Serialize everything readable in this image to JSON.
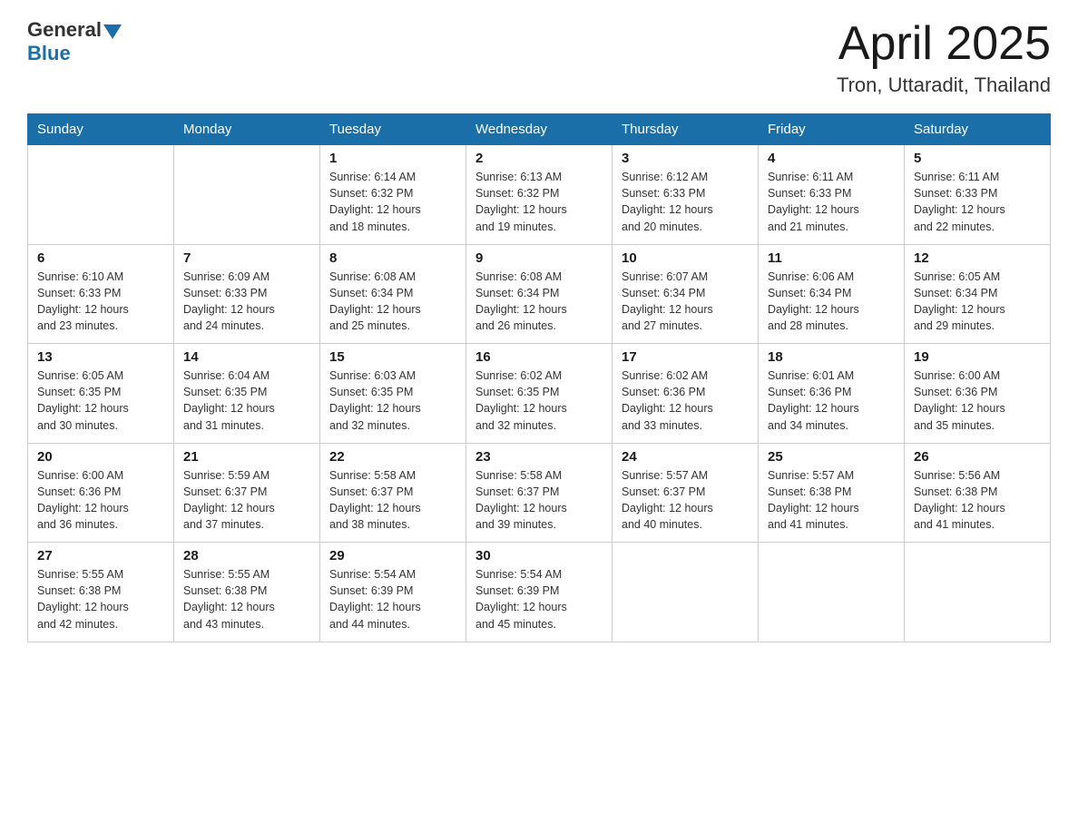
{
  "header": {
    "logo_general": "General",
    "logo_blue": "Blue",
    "month": "April 2025",
    "location": "Tron, Uttaradit, Thailand"
  },
  "weekdays": [
    "Sunday",
    "Monday",
    "Tuesday",
    "Wednesday",
    "Thursday",
    "Friday",
    "Saturday"
  ],
  "weeks": [
    [
      {
        "day": "",
        "info": ""
      },
      {
        "day": "",
        "info": ""
      },
      {
        "day": "1",
        "info": "Sunrise: 6:14 AM\nSunset: 6:32 PM\nDaylight: 12 hours\nand 18 minutes."
      },
      {
        "day": "2",
        "info": "Sunrise: 6:13 AM\nSunset: 6:32 PM\nDaylight: 12 hours\nand 19 minutes."
      },
      {
        "day": "3",
        "info": "Sunrise: 6:12 AM\nSunset: 6:33 PM\nDaylight: 12 hours\nand 20 minutes."
      },
      {
        "day": "4",
        "info": "Sunrise: 6:11 AM\nSunset: 6:33 PM\nDaylight: 12 hours\nand 21 minutes."
      },
      {
        "day": "5",
        "info": "Sunrise: 6:11 AM\nSunset: 6:33 PM\nDaylight: 12 hours\nand 22 minutes."
      }
    ],
    [
      {
        "day": "6",
        "info": "Sunrise: 6:10 AM\nSunset: 6:33 PM\nDaylight: 12 hours\nand 23 minutes."
      },
      {
        "day": "7",
        "info": "Sunrise: 6:09 AM\nSunset: 6:33 PM\nDaylight: 12 hours\nand 24 minutes."
      },
      {
        "day": "8",
        "info": "Sunrise: 6:08 AM\nSunset: 6:34 PM\nDaylight: 12 hours\nand 25 minutes."
      },
      {
        "day": "9",
        "info": "Sunrise: 6:08 AM\nSunset: 6:34 PM\nDaylight: 12 hours\nand 26 minutes."
      },
      {
        "day": "10",
        "info": "Sunrise: 6:07 AM\nSunset: 6:34 PM\nDaylight: 12 hours\nand 27 minutes."
      },
      {
        "day": "11",
        "info": "Sunrise: 6:06 AM\nSunset: 6:34 PM\nDaylight: 12 hours\nand 28 minutes."
      },
      {
        "day": "12",
        "info": "Sunrise: 6:05 AM\nSunset: 6:34 PM\nDaylight: 12 hours\nand 29 minutes."
      }
    ],
    [
      {
        "day": "13",
        "info": "Sunrise: 6:05 AM\nSunset: 6:35 PM\nDaylight: 12 hours\nand 30 minutes."
      },
      {
        "day": "14",
        "info": "Sunrise: 6:04 AM\nSunset: 6:35 PM\nDaylight: 12 hours\nand 31 minutes."
      },
      {
        "day": "15",
        "info": "Sunrise: 6:03 AM\nSunset: 6:35 PM\nDaylight: 12 hours\nand 32 minutes."
      },
      {
        "day": "16",
        "info": "Sunrise: 6:02 AM\nSunset: 6:35 PM\nDaylight: 12 hours\nand 32 minutes."
      },
      {
        "day": "17",
        "info": "Sunrise: 6:02 AM\nSunset: 6:36 PM\nDaylight: 12 hours\nand 33 minutes."
      },
      {
        "day": "18",
        "info": "Sunrise: 6:01 AM\nSunset: 6:36 PM\nDaylight: 12 hours\nand 34 minutes."
      },
      {
        "day": "19",
        "info": "Sunrise: 6:00 AM\nSunset: 6:36 PM\nDaylight: 12 hours\nand 35 minutes."
      }
    ],
    [
      {
        "day": "20",
        "info": "Sunrise: 6:00 AM\nSunset: 6:36 PM\nDaylight: 12 hours\nand 36 minutes."
      },
      {
        "day": "21",
        "info": "Sunrise: 5:59 AM\nSunset: 6:37 PM\nDaylight: 12 hours\nand 37 minutes."
      },
      {
        "day": "22",
        "info": "Sunrise: 5:58 AM\nSunset: 6:37 PM\nDaylight: 12 hours\nand 38 minutes."
      },
      {
        "day": "23",
        "info": "Sunrise: 5:58 AM\nSunset: 6:37 PM\nDaylight: 12 hours\nand 39 minutes."
      },
      {
        "day": "24",
        "info": "Sunrise: 5:57 AM\nSunset: 6:37 PM\nDaylight: 12 hours\nand 40 minutes."
      },
      {
        "day": "25",
        "info": "Sunrise: 5:57 AM\nSunset: 6:38 PM\nDaylight: 12 hours\nand 41 minutes."
      },
      {
        "day": "26",
        "info": "Sunrise: 5:56 AM\nSunset: 6:38 PM\nDaylight: 12 hours\nand 41 minutes."
      }
    ],
    [
      {
        "day": "27",
        "info": "Sunrise: 5:55 AM\nSunset: 6:38 PM\nDaylight: 12 hours\nand 42 minutes."
      },
      {
        "day": "28",
        "info": "Sunrise: 5:55 AM\nSunset: 6:38 PM\nDaylight: 12 hours\nand 43 minutes."
      },
      {
        "day": "29",
        "info": "Sunrise: 5:54 AM\nSunset: 6:39 PM\nDaylight: 12 hours\nand 44 minutes."
      },
      {
        "day": "30",
        "info": "Sunrise: 5:54 AM\nSunset: 6:39 PM\nDaylight: 12 hours\nand 45 minutes."
      },
      {
        "day": "",
        "info": ""
      },
      {
        "day": "",
        "info": ""
      },
      {
        "day": "",
        "info": ""
      }
    ]
  ]
}
